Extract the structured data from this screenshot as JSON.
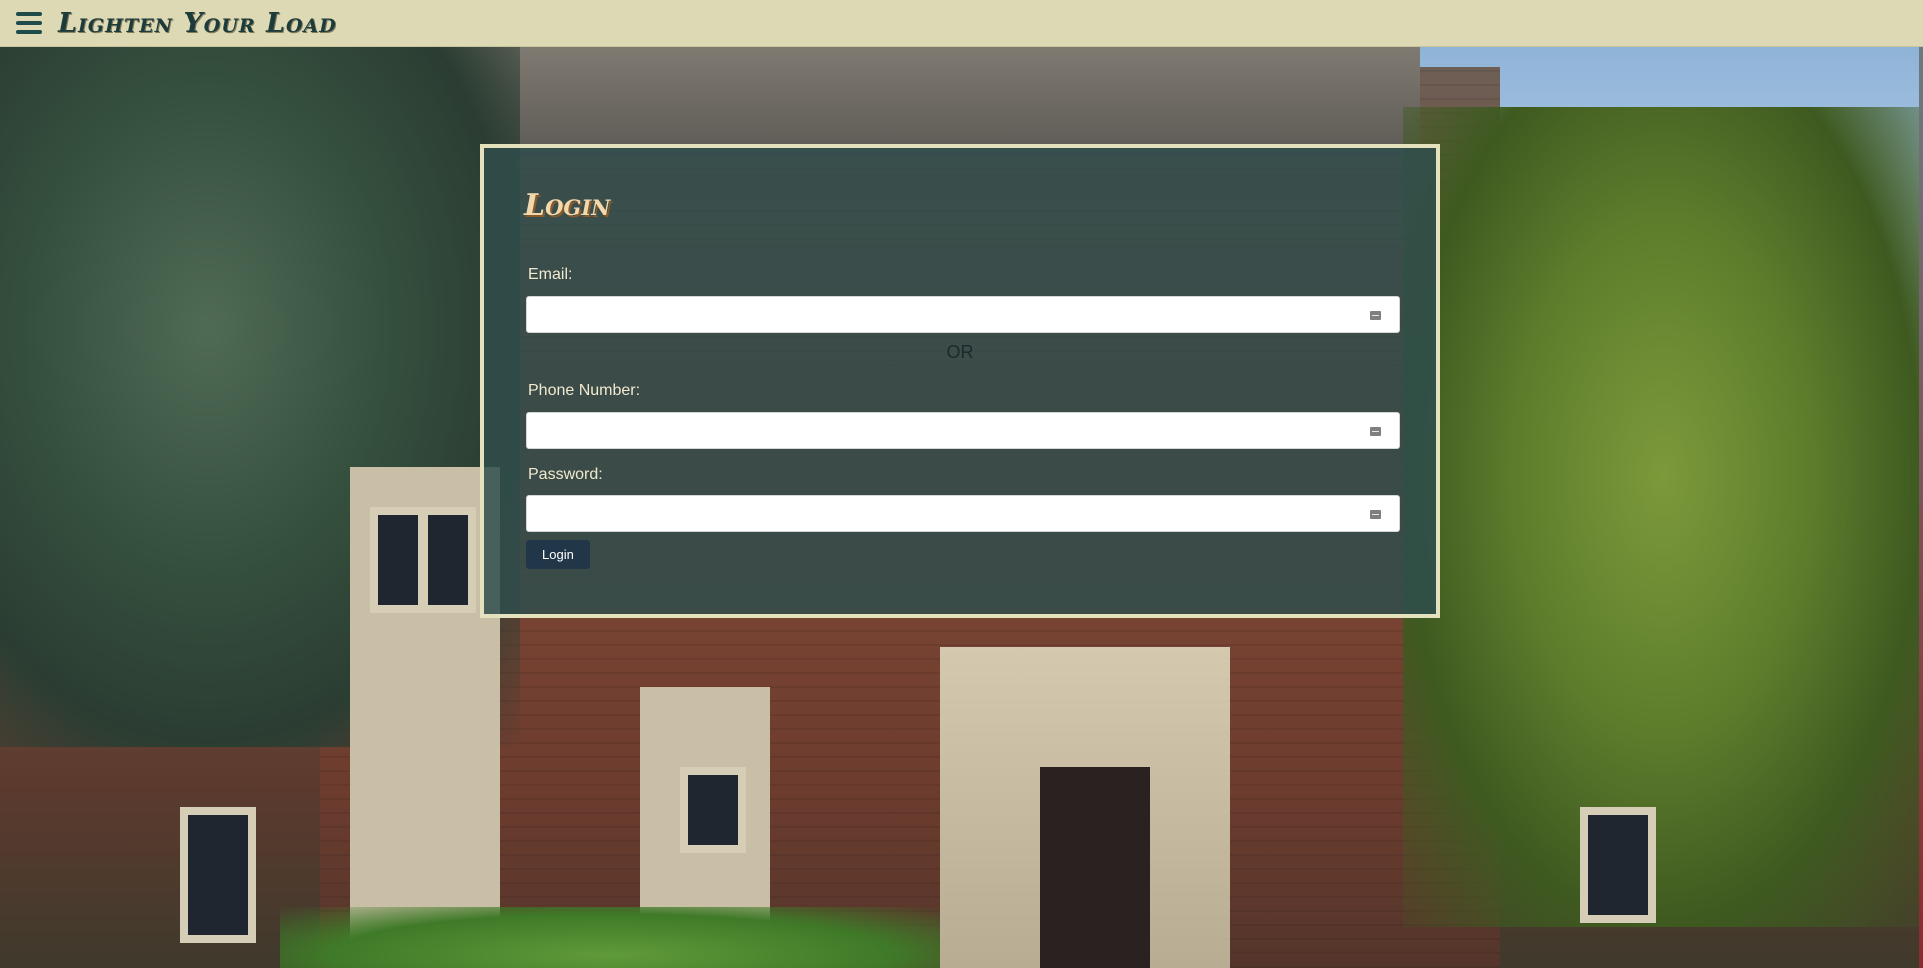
{
  "header": {
    "title": "Lighten Your Load",
    "menu_icon": "hamburger-menu-icon"
  },
  "login": {
    "title": "Login",
    "email_label": "Email:",
    "email_value": "",
    "or_text": "OR",
    "phone_label": "Phone Number:",
    "phone_value": "",
    "password_label": "Password:",
    "password_value": "",
    "field_icon": "keyboard-icon",
    "button_label": "Login"
  },
  "colors": {
    "topbar": "#dcd9b4",
    "title_text": "#1e3b3b",
    "panel_bg": "#2f4e4c",
    "panel_border": "#e4e2bd",
    "login_heading": "#f1d8ad",
    "button_bg": "#22364a"
  }
}
